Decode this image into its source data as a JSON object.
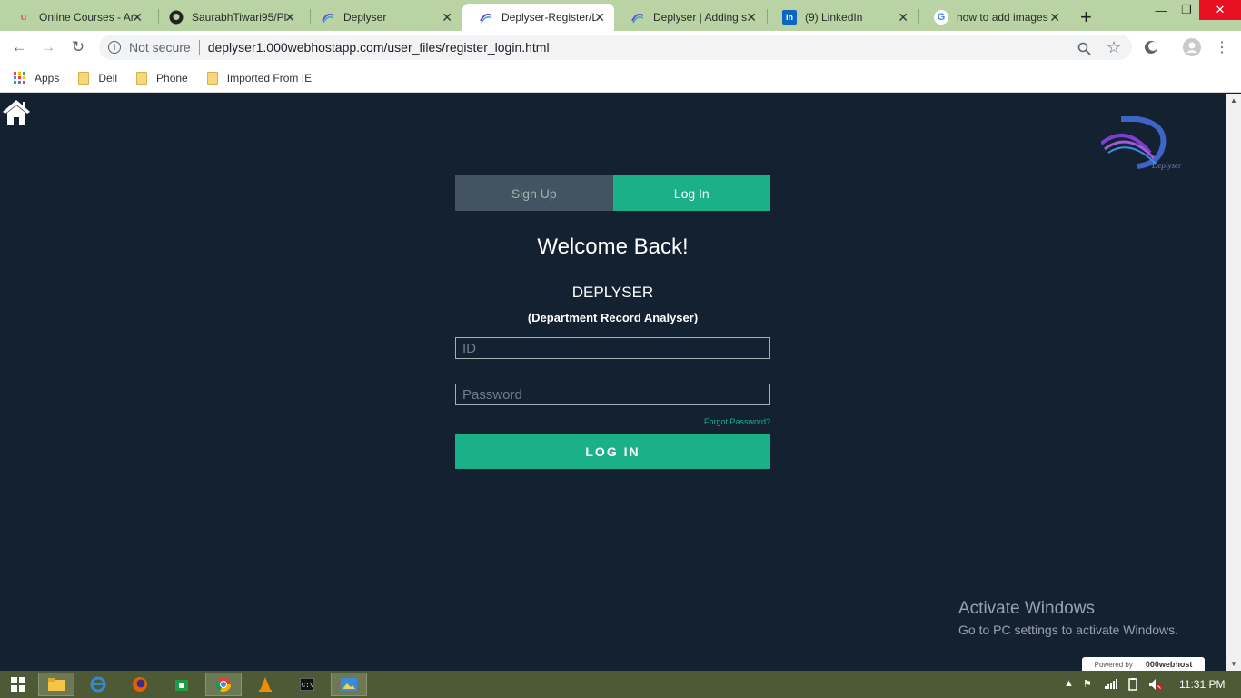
{
  "tabs": [
    {
      "title": "Online Courses - Ar",
      "icon": "udemy-icon"
    },
    {
      "title": "SaurabhTiwari95/Pl",
      "icon": "github-icon"
    },
    {
      "title": "Deplyser",
      "icon": "deplyser-icon"
    },
    {
      "title": "Deplyser-Register/L",
      "icon": "deplyser-icon",
      "active": true
    },
    {
      "title": "Deplyser | Adding s",
      "icon": "deplyser-icon"
    },
    {
      "title": "(9) LinkedIn",
      "icon": "linkedin-icon"
    },
    {
      "title": "how to add images",
      "icon": "google-icon"
    }
  ],
  "address": {
    "security": "Not secure",
    "url": "deplyser1.000webhostapp.com/user_files/register_login.html"
  },
  "bookmarks": {
    "apps": "Apps",
    "items": [
      "Dell",
      "Phone",
      "Imported From IE"
    ]
  },
  "logo": {
    "text": "Deplyser"
  },
  "form": {
    "signup_tab": "Sign Up",
    "login_tab": "Log In",
    "welcome": "Welcome Back!",
    "app_name": "DEPLYSER",
    "app_subtitle": "(Department Record Analyser)",
    "id_placeholder": "ID",
    "password_placeholder": "Password",
    "forgot": "Forgot Password?",
    "login_button": "LOG IN"
  },
  "watermark": {
    "title": "Activate Windows",
    "subtitle": "Go to PC settings to activate Windows."
  },
  "powered": {
    "label": "Powered by",
    "brand": "000webhost"
  },
  "taskbar": {
    "clock": "11:31 PM"
  },
  "colors": {
    "accent": "#1ab188",
    "background": "#142130",
    "inactive_tab": "#435361"
  }
}
